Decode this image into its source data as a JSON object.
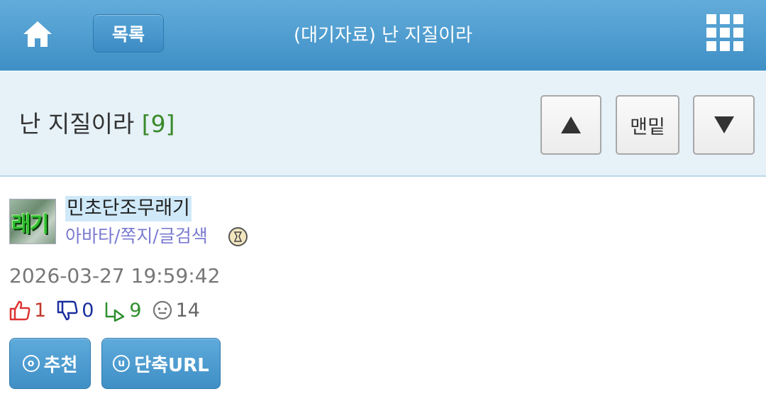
{
  "topbar": {
    "home_icon": "home-icon",
    "list_label": "목록",
    "title": "(대기자료) 난 지질이라",
    "menu_icon": "grid-menu-icon"
  },
  "post": {
    "title": "난 지질이라",
    "comment_count": "[9]",
    "nav": {
      "up_icon": "triangle-up-icon",
      "bottom_label": "맨밑",
      "down_icon": "triangle-down-icon"
    }
  },
  "author": {
    "avatar_text": "래기",
    "name": "민초단조무래기",
    "links": "아바타/쪽지/글검색",
    "badge_icon": "level-badge-icon"
  },
  "meta": {
    "timestamp": "2026-03-27 19:59:42",
    "upvotes": "1",
    "downvotes": "0",
    "replies": "9",
    "views": "14"
  },
  "actions": {
    "recommend_label": "추천",
    "shorturl_label": "단축URL"
  },
  "colors": {
    "topbar": "#4f9ed0",
    "header_bg": "#e6f1f8",
    "comment_count": "#3a8a2a",
    "link_text": "#7b7bd1"
  }
}
